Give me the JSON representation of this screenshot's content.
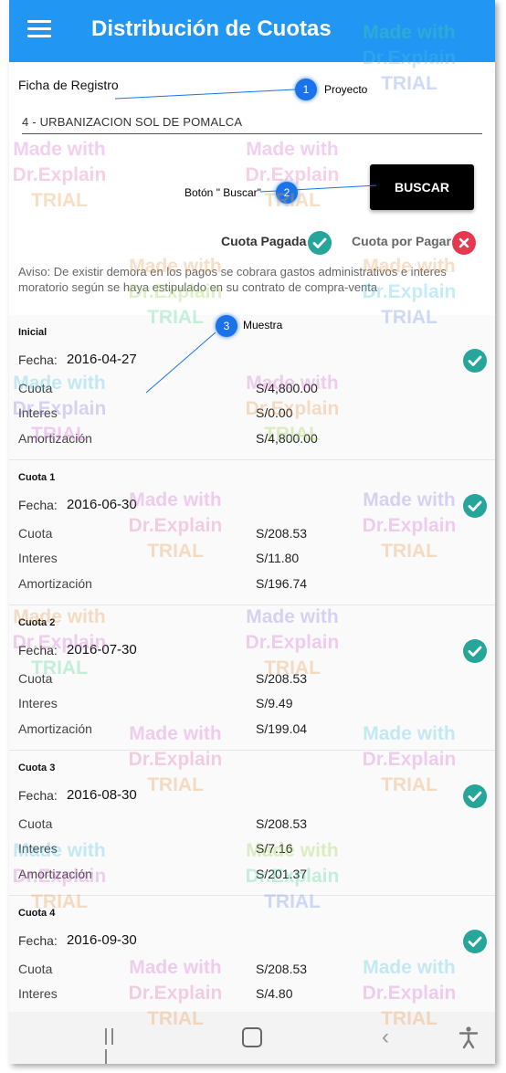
{
  "app": {
    "title": "Distribución de Cuotas"
  },
  "form": {
    "label": "Ficha de Registro",
    "project_value": "4 - URBANIZACION SOL DE POMALCA",
    "search_button": "BUSCAR"
  },
  "legend": {
    "paid": "Cuota Pagada",
    "unpaid": "Cuota por Pagar"
  },
  "notice": "Aviso: De existir demora en los pagos se cobrara gastos administrativos e interes moratorio según se haya estipulado en su contrato de compra-venta",
  "labels": {
    "fecha": "Fecha:",
    "cuota": "Cuota",
    "interes": "Interes",
    "amortizacion": "Amortización"
  },
  "cuotas": [
    {
      "title": "Inicial",
      "fecha": "2016-04-27",
      "cuota": "S/4,800.00",
      "interes": "S/0.00",
      "amortizacion": "S/4,800.00",
      "status": "paid"
    },
    {
      "title": "Cuota 1",
      "fecha": "2016-06-30",
      "cuota": "S/208.53",
      "interes": "S/11.80",
      "amortizacion": "S/196.74",
      "status": "paid"
    },
    {
      "title": "Cuota 2",
      "fecha": "2016-07-30",
      "cuota": "S/208.53",
      "interes": "S/9.49",
      "amortizacion": "S/199.04",
      "status": "paid"
    },
    {
      "title": "Cuota 3",
      "fecha": "2016-08-30",
      "cuota": "S/208.53",
      "interes": "S/7.16",
      "amortizacion": "S/201.37",
      "status": "paid"
    },
    {
      "title": "Cuota 4",
      "fecha": "2016-09-30",
      "cuota": "S/208.53",
      "interes": "S/4.80",
      "amortizacion": "",
      "status": "paid"
    }
  ],
  "callouts": [
    {
      "number": "1",
      "text": "Proyecto"
    },
    {
      "number": "2",
      "text": "Botón \" Buscar\""
    },
    {
      "number": "3",
      "text": "Muestra"
    }
  ],
  "watermark": {
    "line1": "Made with",
    "line2": "Dr.Explain",
    "line3": "TRIAL"
  },
  "colors": {
    "appbar": "#2196f3",
    "paid": "#26a69a",
    "unpaid": "#e53950",
    "button": "#000000"
  },
  "icons": {
    "menu": "hamburger-menu-icon",
    "paid": "check-circle-icon",
    "unpaid": "x-circle-icon",
    "nav_recent": "recent-apps-icon",
    "nav_home": "home-icon",
    "nav_back": "back-icon",
    "nav_access": "accessibility-icon"
  }
}
